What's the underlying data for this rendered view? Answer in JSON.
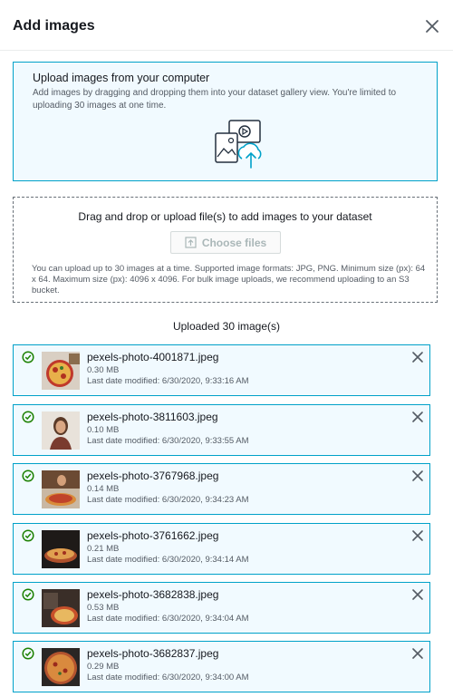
{
  "modal": {
    "title": "Add images"
  },
  "info": {
    "title": "Upload images from your computer",
    "description": "Add images by dragging and dropping them into your dataset gallery view. You're limited to uploading 30 images at one time."
  },
  "dropzone": {
    "title": "Drag and drop or upload file(s) to add images to your dataset",
    "choose_label": "Choose files",
    "help": "You can upload up to 30 images at a time. Supported image formats: JPG, PNG. Minimum size (px): 64 x 64. Maximum size (px): 4096 x 4096. For bulk image uploads, we recommend uploading to an S3 bucket."
  },
  "uploaded_label": "Uploaded 30 image(s)",
  "files": [
    {
      "name": "pexels-photo-4001871.jpeg",
      "size": "0.30 MB",
      "date": "Last date modified: 6/30/2020, 9:33:16 AM"
    },
    {
      "name": "pexels-photo-3811603.jpeg",
      "size": "0.10 MB",
      "date": "Last date modified: 6/30/2020, 9:33:55 AM"
    },
    {
      "name": "pexels-photo-3767968.jpeg",
      "size": "0.14 MB",
      "date": "Last date modified: 6/30/2020, 9:34:23 AM"
    },
    {
      "name": "pexels-photo-3761662.jpeg",
      "size": "0.21 MB",
      "date": "Last date modified: 6/30/2020, 9:34:14 AM"
    },
    {
      "name": "pexels-photo-3682838.jpeg",
      "size": "0.53 MB",
      "date": "Last date modified: 6/30/2020, 9:34:04 AM"
    },
    {
      "name": "pexels-photo-3682837.jpeg",
      "size": "0.29 MB",
      "date": "Last date modified: 6/30/2020, 9:34:00 AM"
    }
  ],
  "colors": {
    "accent": "#00a1c9",
    "success": "#1d8102",
    "info_bg": "#f1faff"
  }
}
